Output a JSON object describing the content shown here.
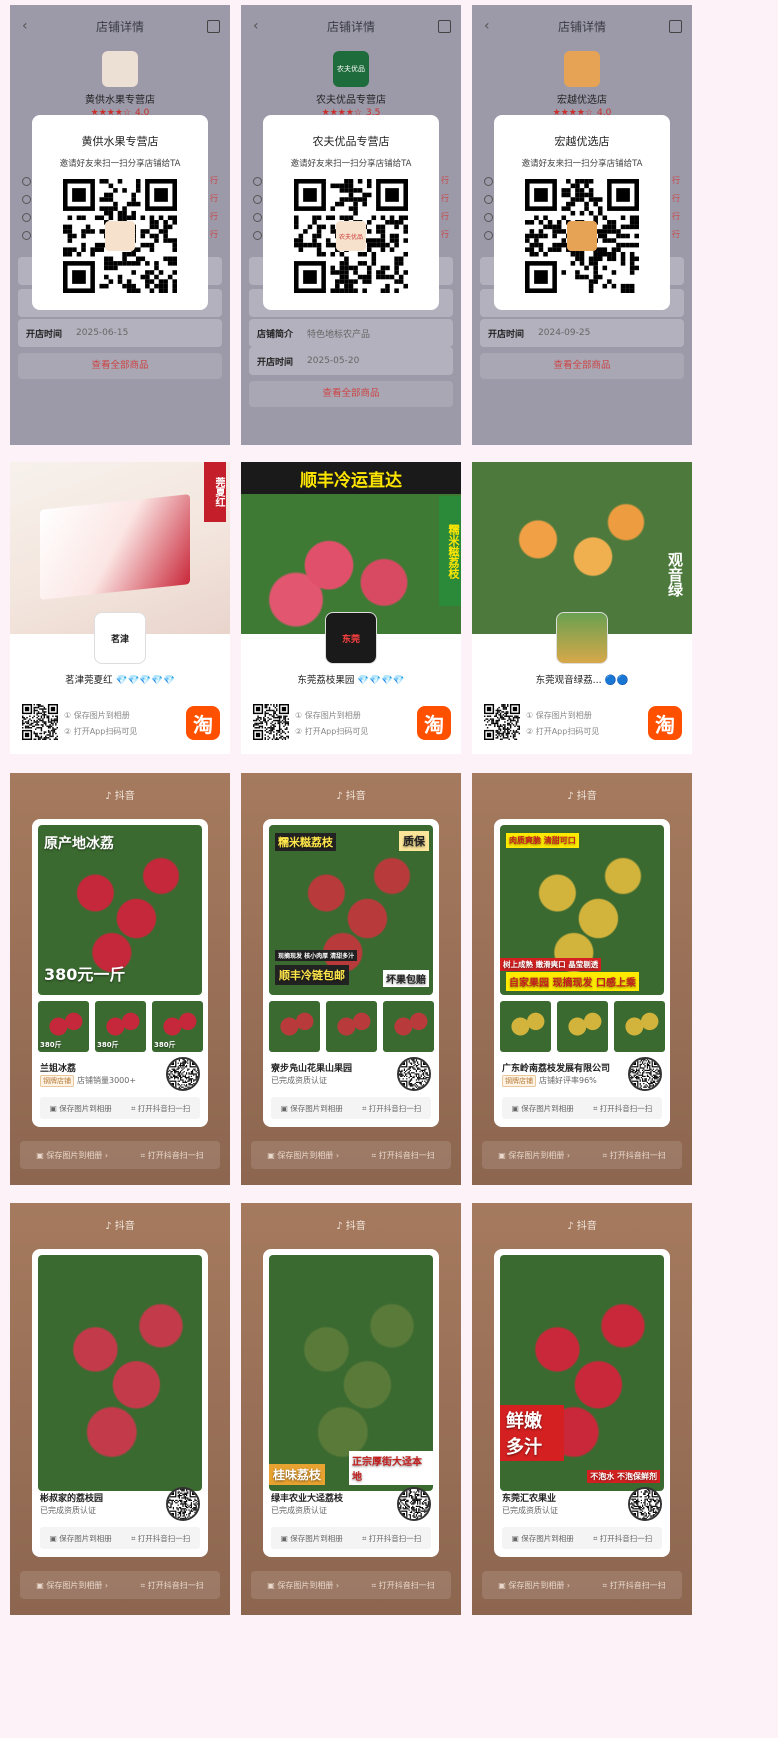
{
  "row1": [
    {
      "header": "店铺详情",
      "name": "黄供水果专营店",
      "score": "4.0",
      "stars": "★★★★☆",
      "qr_title": "黄供水果专营店",
      "qr_sub": "邀请好友来扫一扫分享店铺给TA",
      "logo_text": "",
      "rows": [
        {
          "k": "开店时间",
          "v": "2025-06-15"
        }
      ],
      "all_label": "查看全部商品",
      "logo_color": "#f3e6d6"
    },
    {
      "header": "店铺详情",
      "name": "农夫优品专营店",
      "score": "3.5",
      "stars": "★★★★☆",
      "qr_title": "农夫优品专营店",
      "qr_sub": "邀请好友来扫一扫分享店铺给TA",
      "logo_text": "农夫优品",
      "rows": [
        {
          "k": "店铺简介",
          "v": "特色地标农产品"
        },
        {
          "k": "开店时间",
          "v": "2025-05-20"
        }
      ],
      "all_label": "查看全部商品",
      "logo_color": "#1e6b3b"
    },
    {
      "header": "店铺详情",
      "name": "宏越优选店",
      "score": "4.0",
      "stars": "★★★★☆",
      "qr_title": "宏越优选店",
      "qr_sub": "邀请好友来扫一扫分享店铺给TA",
      "logo_text": "",
      "rows": [
        {
          "k": "开店时间",
          "v": "2024-09-25"
        }
      ],
      "all_label": "查看全部商品",
      "logo_color": "#e7a355"
    }
  ],
  "row2": [
    {
      "name": "茗津莞夏红",
      "diamonds": "💎💎💎💎💎",
      "banner": "莞夏红",
      "avatar": "茗津",
      "step1": "① 保存图片到相册",
      "step2": "② 打开App扫码可见",
      "tao": "淘"
    },
    {
      "name": "东莞荔枝果园",
      "diamonds": "💎💎💎💎",
      "banner": "顺丰冷运直达",
      "side": "糯米糍荔枝",
      "avatar": "东莞",
      "step1": "① 保存图片到相册",
      "step2": "② 打开App扫码可见",
      "tao": "淘"
    },
    {
      "name": "东莞观音绿荔...",
      "diamonds": "🔵🔵",
      "side": "观音绿",
      "avatar": "",
      "step1": "① 保存图片到相册",
      "step2": "② 打开App扫码可见",
      "tao": "淘"
    }
  ],
  "douyin": [
    {
      "logo": "♪ 抖音",
      "shop": "兰姐冰荔",
      "sub": "店铺销量3000+",
      "badge": "钢牌店铺",
      "over1": "原产地冰荔",
      "over2": "380元一斤",
      "thumb": "380斤",
      "save": "保存图片到相册",
      "open": "打开抖音扫一扫",
      "bg": "#c4283a"
    },
    {
      "logo": "♪ 抖音",
      "shop": "寮步凫山花果山果园",
      "sub": "已完成资质认证",
      "badge": "",
      "over1": "糯米糍荔枝",
      "over2": "顺丰冷链包邮",
      "tag": "质保",
      "tag2": "坏果包赔",
      "strip": "现摘现发 核小肉厚 清甜多汁",
      "save": "保存图片到相册",
      "open": "打开抖音扫一扫",
      "bg": "#b83a3a"
    },
    {
      "logo": "♪ 抖音",
      "shop": "广东岭南荔枝发展有限公司",
      "sub": "店铺好评率96%",
      "badge": "钢牌店铺",
      "over1": "肉质爽脆 清甜可口",
      "over2": "自家果园 现摘现发 口感上乘",
      "strip": "树上成熟 嫩滑爽口 晶莹剔透",
      "save": "保存图片到相册",
      "open": "打开抖音扫一扫",
      "bg": "#d2b33c"
    },
    {
      "logo": "♪ 抖音",
      "shop": "彬叔家的荔枝园",
      "sub": "已完成资质认证",
      "badge": "",
      "save": "保存图片到相册",
      "open": "打开抖音扫一扫",
      "bg": "#c33a4a"
    },
    {
      "logo": "♪ 抖音",
      "shop": "绿丰农业大迳荔枝",
      "sub": "已完成资质认证",
      "badge": "",
      "over1": "桂味荔枝",
      "over2": "正宗厚街大迳本地",
      "save": "保存图片到相册",
      "open": "打开抖音扫一扫",
      "bg": "#5a7a3a"
    },
    {
      "logo": "♪ 抖音",
      "shop": "东莞汇农果业",
      "sub": "已完成资质认证",
      "badge": "",
      "over1": "鲜嫩多汁",
      "over2": "不泡水 不泡保鲜剂",
      "save": "保存图片到相册",
      "open": "打开抖音扫一扫",
      "bg": "#c8283a"
    }
  ],
  "colors": {
    "accent": "#c9302c",
    "taobao": "#ff5000",
    "douyin_bg": "#9b7158"
  }
}
